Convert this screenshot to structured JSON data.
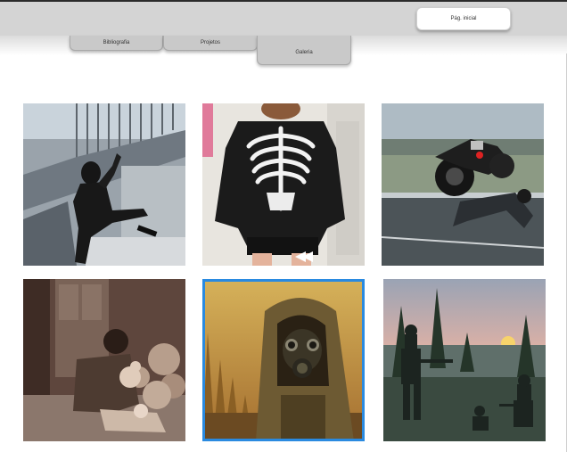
{
  "nav": {
    "tabs": [
      {
        "label": "Bibliografia"
      },
      {
        "label": "Projetos"
      },
      {
        "label": "Galeria"
      }
    ],
    "home_label": "Pág. inicial"
  },
  "gallery": {
    "selected_index": 4,
    "images": [
      {
        "icon": "person-climbing-staircase-photo"
      },
      {
        "icon": "skeleton-hoodie-photo"
      },
      {
        "icon": "motorcycle-crash-photo"
      },
      {
        "icon": "person-with-teddy-bears-photo"
      },
      {
        "icon": "gas-mask-hooded-figure-photo"
      },
      {
        "icon": "pixel-art-soldiers-forest-photo"
      }
    ]
  }
}
